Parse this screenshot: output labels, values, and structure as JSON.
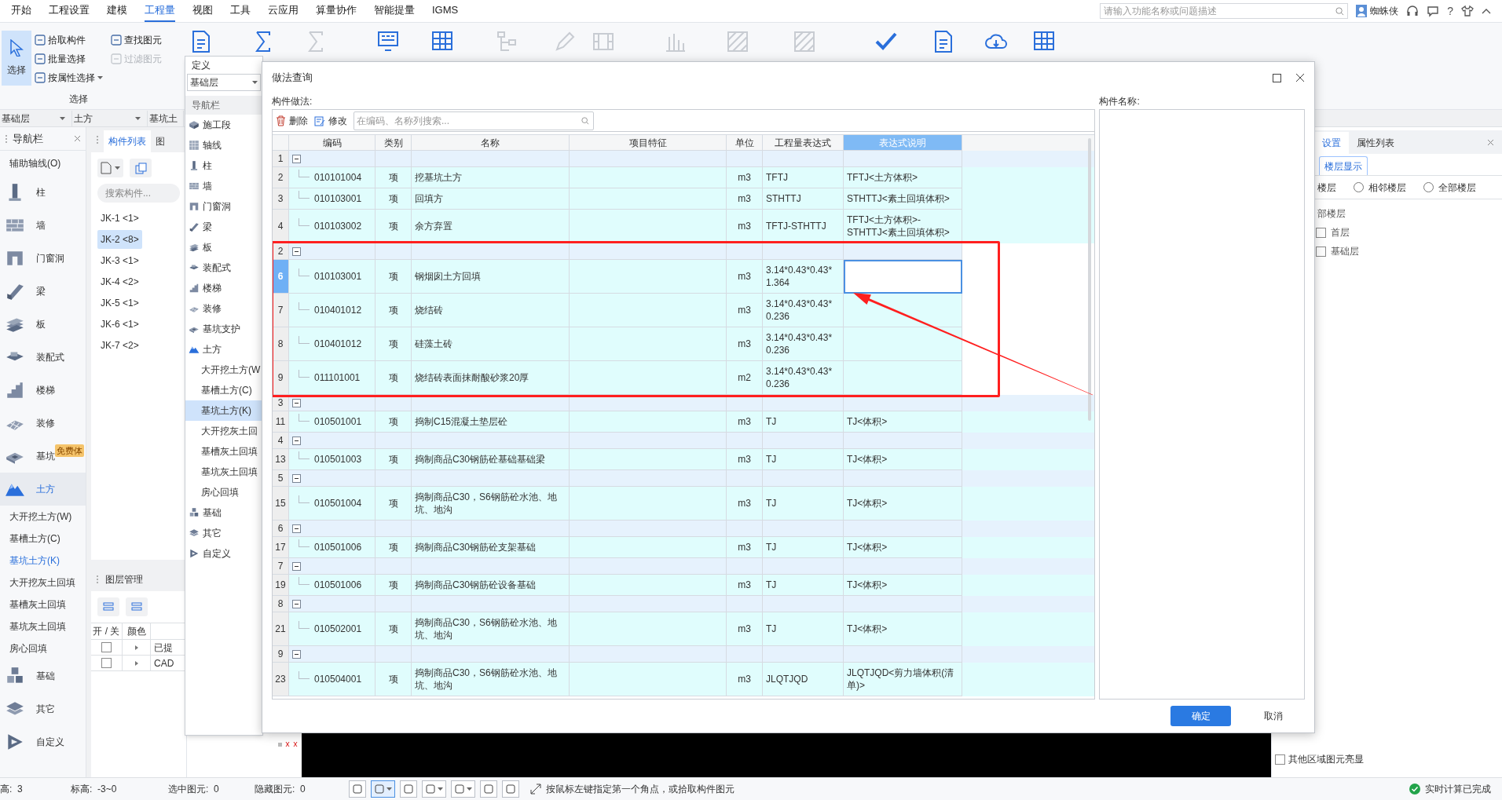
{
  "menu": [
    {
      "label": "开始",
      "selected": false
    },
    {
      "label": "工程设置",
      "selected": false
    },
    {
      "label": "建模",
      "selected": false
    },
    {
      "label": "工程量",
      "selected": true
    },
    {
      "label": "视图",
      "selected": false
    },
    {
      "label": "工具",
      "selected": false
    },
    {
      "label": "云应用",
      "selected": false
    },
    {
      "label": "算量协作",
      "selected": false
    },
    {
      "label": "智能提量",
      "selected": false
    },
    {
      "label": "IGMS",
      "selected": false
    }
  ],
  "search": {
    "placeholder": "请输入功能名称或问题描述"
  },
  "user": {
    "name": "蜘蛛侠"
  },
  "help": "?",
  "ribbon": {
    "select_button": {
      "label": "选择",
      "selected": true
    },
    "tools": [
      {
        "label": "拾取构件",
        "disabled": false,
        "dropdown": false
      },
      {
        "label": "批量选择",
        "disabled": false,
        "dropdown": false
      },
      {
        "label": "按属性选择",
        "disabled": false,
        "dropdown": true
      },
      {
        "label": "查找图元",
        "disabled": false,
        "dropdown": false
      },
      {
        "label": "过滤图元",
        "disabled": true,
        "dropdown": false
      }
    ],
    "group_label": "选择",
    "icon_buttons": [
      {
        "disabled": false
      },
      {
        "disabled": false
      },
      {
        "disabled": true
      },
      {
        "disabled": false
      },
      {
        "disabled": false
      },
      {
        "disabled": true
      },
      {
        "disabled": true
      },
      {
        "disabled": true
      },
      {
        "disabled": true
      },
      {
        "disabled": true
      },
      {
        "disabled": true
      },
      {
        "disabled": false
      },
      {
        "disabled": false
      },
      {
        "disabled": false
      },
      {
        "disabled": false
      }
    ]
  },
  "selectors": [
    "基础层",
    "土方",
    "基坑土"
  ],
  "nav": {
    "title": "导航栏",
    "top_item": "辅助轴线(O)",
    "items": [
      {
        "label": "柱",
        "selected": false
      },
      {
        "label": "墙",
        "selected": false
      },
      {
        "label": "门窗洞",
        "selected": false
      },
      {
        "label": "梁",
        "selected": false
      },
      {
        "label": "板",
        "selected": false
      },
      {
        "label": "装配式",
        "selected": false
      },
      {
        "label": "楼梯",
        "selected": false
      },
      {
        "label": "装修",
        "selected": false
      },
      {
        "label": "基坑",
        "selected": false,
        "badge": "免费体"
      },
      {
        "label": "土方",
        "selected": true,
        "children": [
          {
            "label": "大开挖土方(W)",
            "selected": false
          },
          {
            "label": "基槽土方(C)",
            "selected": false
          },
          {
            "label": "基坑土方(K)",
            "selected": true
          },
          {
            "label": "大开挖灰土回填",
            "selected": false
          },
          {
            "label": "基槽灰土回填",
            "selected": false
          },
          {
            "label": "基坑灰土回填",
            "selected": false
          },
          {
            "label": "房心回填",
            "selected": false
          }
        ]
      },
      {
        "label": "基础",
        "selected": false
      },
      {
        "label": "其它",
        "selected": false
      },
      {
        "label": "自定义",
        "selected": false
      }
    ]
  },
  "components": {
    "tabs": [
      {
        "label": "构件列表",
        "selected": true
      },
      {
        "label": "图",
        "selected": false
      }
    ],
    "search_placeholder": "搜索构件...",
    "items": [
      {
        "label": "JK-1 <1>",
        "selected": false
      },
      {
        "label": "JK-2 <8>",
        "selected": true
      },
      {
        "label": "JK-3 <1>",
        "selected": false
      },
      {
        "label": "JK-4 <2>",
        "selected": false
      },
      {
        "label": "JK-5 <1>",
        "selected": false
      },
      {
        "label": "JK-6 <1>",
        "selected": false
      },
      {
        "label": "JK-7 <2>",
        "selected": false
      }
    ]
  },
  "layers": {
    "title": "图层管理",
    "columns": [
      "开 / 关",
      "颜色"
    ],
    "rows": [
      {
        "checked": false,
        "label": "已提"
      },
      {
        "checked": false,
        "label": "CAD"
      }
    ]
  },
  "definition": {
    "title": "定义",
    "floor": "基础层",
    "nav_title": "导航栏",
    "items": [
      {
        "label": "施工段"
      },
      {
        "label": "轴线"
      },
      {
        "label": "柱"
      },
      {
        "label": "墙"
      },
      {
        "label": "门窗洞"
      },
      {
        "label": "梁"
      },
      {
        "label": "板"
      },
      {
        "label": "装配式"
      },
      {
        "label": "楼梯"
      },
      {
        "label": "装修"
      },
      {
        "label": "基坑支护"
      },
      {
        "label": "土方",
        "children": [
          {
            "label": "大开挖土方(W",
            "selected": false
          },
          {
            "label": "基槽土方(C)",
            "selected": false
          },
          {
            "label": "基坑土方(K)",
            "selected": true
          },
          {
            "label": "大开挖灰土回",
            "selected": false
          },
          {
            "label": "基槽灰土回填",
            "selected": false
          },
          {
            "label": "基坑灰土回填",
            "selected": false
          },
          {
            "label": "房心回填",
            "selected": false
          }
        ]
      },
      {
        "label": "基础"
      },
      {
        "label": "其它"
      },
      {
        "label": "自定义"
      }
    ]
  },
  "dialog": {
    "title": "做法查询",
    "section_label": "构件做法:",
    "side_label": "构件名称:",
    "toolbar": [
      {
        "label": "删除"
      },
      {
        "label": "修改"
      }
    ],
    "search_placeholder": "在编码、名称列搜索...",
    "columns": [
      {
        "label": "编码",
        "selected": false
      },
      {
        "label": "类别",
        "selected": false
      },
      {
        "label": "名称",
        "selected": false
      },
      {
        "label": "项目特征",
        "selected": false
      },
      {
        "label": "单位",
        "selected": false
      },
      {
        "label": "工程量表达式",
        "selected": false
      },
      {
        "label": "表达式说明",
        "selected": true
      }
    ],
    "rows": [
      {
        "kind": "group",
        "number": "1",
        "expanded": true,
        "highlighted": false
      },
      {
        "kind": "item",
        "number": "2",
        "code": "010101004",
        "type": "项",
        "name": "挖基坑土方",
        "unit": "m3",
        "expression": "TFTJ",
        "description": "TFTJ<土方体积>",
        "selected": false,
        "highlighted": false
      },
      {
        "kind": "item",
        "number": "3",
        "code": "010103001",
        "type": "项",
        "name": "回填方",
        "unit": "m3",
        "expression": "STHTTJ",
        "description": "STHTTJ<素土回填体积>",
        "selected": false,
        "highlighted": false
      },
      {
        "kind": "item",
        "number": "4",
        "code": "010103002",
        "type": "项",
        "name": "余方弃置",
        "unit": "m3",
        "expression": "TFTJ-STHTTJ",
        "description": "TFTJ<土方体积>-STHTTJ<素土回填体积>",
        "selected": false,
        "highlighted": false
      },
      {
        "kind": "group",
        "number": "2",
        "expanded": true,
        "highlighted": true
      },
      {
        "kind": "item",
        "number": "6",
        "code": "010103001",
        "type": "项",
        "name": "钢烟囱土方回填",
        "unit": "m3",
        "expression": "3.14*0.43*0.43*1.364",
        "selected": true,
        "highlighted": true
      },
      {
        "kind": "item",
        "number": "7",
        "code": "010401012",
        "type": "项",
        "name": "烧结砖",
        "unit": "m3",
        "expression": "3.14*0.43*0.43*0.236",
        "selected": false,
        "highlighted": true
      },
      {
        "kind": "item",
        "number": "8",
        "code": "010401012",
        "type": "项",
        "name": "硅藻土砖",
        "unit": "m3",
        "expression": "3.14*0.43*0.43*0.236",
        "selected": false,
        "highlighted": true
      },
      {
        "kind": "item",
        "number": "9",
        "code": "011101001",
        "type": "项",
        "name": "烧结砖表面抹耐酸砂浆20厚",
        "unit": "m2",
        "expression": "3.14*0.43*0.43*0.236",
        "selected": false,
        "highlighted": true
      },
      {
        "kind": "group",
        "number": "3",
        "expanded": true,
        "highlighted": false
      },
      {
        "kind": "item",
        "number": "11",
        "code": "010501001",
        "type": "项",
        "name": "捣制C15混凝土垫层砼",
        "unit": "m3",
        "expression": "TJ",
        "description": "TJ<体积>",
        "selected": false,
        "highlighted": false
      },
      {
        "kind": "group",
        "number": "4",
        "expanded": true,
        "highlighted": false
      },
      {
        "kind": "item",
        "number": "13",
        "code": "010501003",
        "type": "项",
        "name": "捣制商品C30钢筋砼基础基础梁",
        "unit": "m3",
        "expression": "TJ",
        "description": "TJ<体积>",
        "selected": false,
        "highlighted": false
      },
      {
        "kind": "group",
        "number": "5",
        "expanded": true,
        "highlighted": false
      },
      {
        "kind": "item",
        "number": "15",
        "code": "010501004",
        "type": "项",
        "name": "捣制商品C30，S6钢筋砼水池、地坑、地沟",
        "unit": "m3",
        "expression": "TJ",
        "description": "TJ<体积>",
        "selected": false,
        "highlighted": false
      },
      {
        "kind": "group",
        "number": "6",
        "expanded": true,
        "highlighted": false
      },
      {
        "kind": "item",
        "number": "17",
        "code": "010501006",
        "type": "项",
        "name": "捣制商品C30钢筋砼支架基础",
        "unit": "m3",
        "expression": "TJ",
        "description": "TJ<体积>",
        "selected": false,
        "highlighted": false
      },
      {
        "kind": "group",
        "number": "7",
        "expanded": true,
        "highlighted": false
      },
      {
        "kind": "item",
        "number": "19",
        "code": "010501006",
        "type": "项",
        "name": "捣制商品C30钢筋砼设备基础",
        "unit": "m3",
        "expression": "TJ",
        "description": "TJ<体积>",
        "selected": false,
        "highlighted": false
      },
      {
        "kind": "group",
        "number": "8",
        "expanded": true,
        "highlighted": false
      },
      {
        "kind": "item",
        "number": "21",
        "code": "010502001",
        "type": "项",
        "name": "捣制商品C30，S6钢筋砼水池、地坑、地沟",
        "unit": "m3",
        "expression": "TJ",
        "description": "TJ<体积>",
        "selected": false,
        "highlighted": false
      },
      {
        "kind": "group",
        "number": "9",
        "expanded": true,
        "highlighted": false
      },
      {
        "kind": "item",
        "number": "23",
        "code": "010504001",
        "type": "项",
        "name": "捣制商品C30，S6钢筋砼水池、地坑、地沟",
        "unit": "m3",
        "expression": "JLQTJQD",
        "description": "JLQTJQD<剪力墙体积(清单)>",
        "selected": false,
        "highlighted": false
      }
    ],
    "buttons": [
      {
        "label": "确定",
        "primary": true
      },
      {
        "label": "取消",
        "primary": false
      }
    ]
  },
  "properties": {
    "tabs": [
      {
        "label": "设置",
        "selected": true
      },
      {
        "label": "属性列表",
        "selected": false
      }
    ],
    "subtab": {
      "label": "楼层显示",
      "selected": true
    },
    "cut_option": "楼层",
    "radios": [
      {
        "label": "相邻楼层",
        "selected": false
      },
      {
        "label": "全部楼层",
        "selected": false
      }
    ],
    "tree_root": "部楼层",
    "floors": [
      {
        "label": "首层",
        "checked": false
      },
      {
        "label": "基础层",
        "checked": false
      }
    ],
    "highlight_option": {
      "label": "其他区域图元亮显",
      "checked": false
    }
  },
  "status": {
    "fields": [
      {
        "label": "高:",
        "value": "3"
      },
      {
        "label": "标高:",
        "value": "-3~0"
      },
      {
        "label": "选中图元:",
        "value": "0"
      },
      {
        "label": "隐藏图元:",
        "value": "0"
      }
    ],
    "tools": [
      {
        "selected": false,
        "dropdown": false
      },
      {
        "selected": true,
        "dropdown": true
      },
      {
        "selected": false,
        "dropdown": false
      },
      {
        "selected": false,
        "dropdown": true
      },
      {
        "selected": false,
        "dropdown": true
      },
      {
        "selected": false,
        "dropdown": false
      },
      {
        "selected": false,
        "dropdown": false
      }
    ],
    "hint": "按鼠标左键指定第一个角点，或拾取构件图元",
    "calc_status": "实时计算已完成"
  }
}
